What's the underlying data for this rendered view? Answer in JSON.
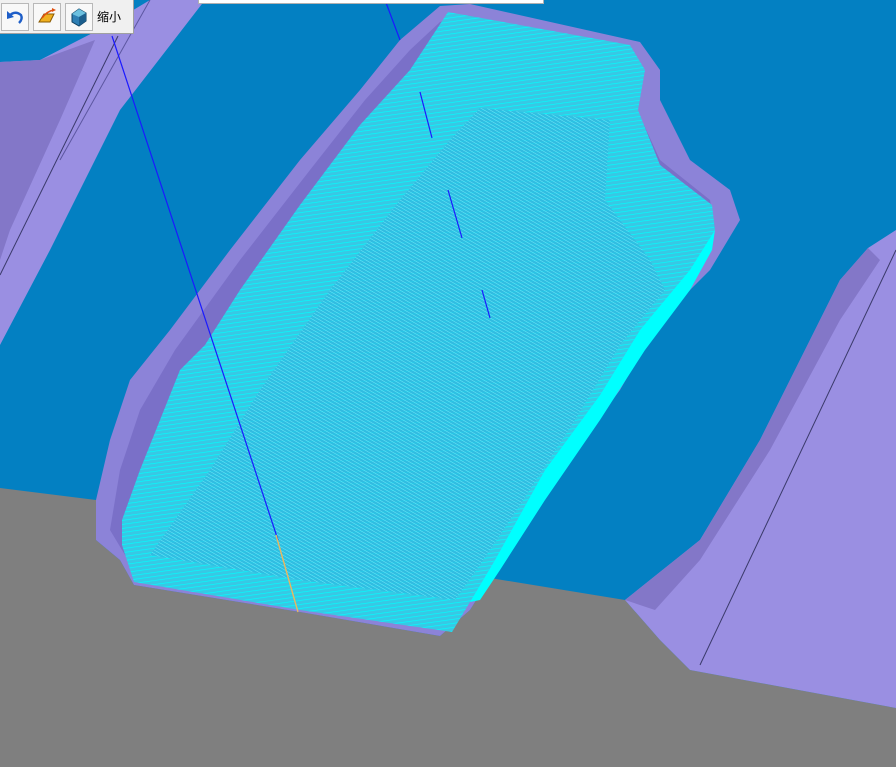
{
  "toolbar": {
    "buttons": [
      {
        "icon": "undo-icon",
        "label": ""
      },
      {
        "icon": "toolpath-edit-icon",
        "label": ""
      },
      {
        "icon": "solid-shade-icon",
        "label": ""
      },
      {
        "icon": "",
        "label": "缩小"
      }
    ]
  },
  "viewport": {
    "background_color": "#0380C2",
    "floor_color": "#7F7F7F",
    "rib_color": "#9A8FE2",
    "rib_shadow_color": "#8377C8",
    "toolpath_color": "#00FFFF",
    "tool_axis_color": "#1A1AFF",
    "entry_move_color": "#E8B860"
  }
}
